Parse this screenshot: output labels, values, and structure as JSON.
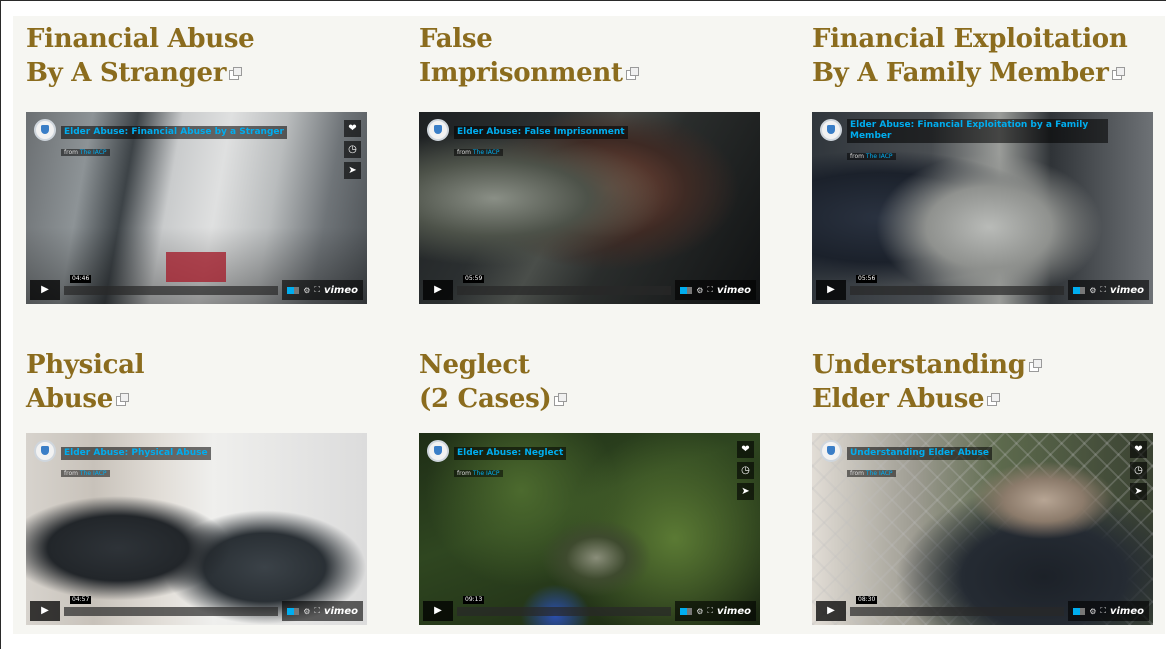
{
  "videos": [
    {
      "title_line1": "Financial Abuse",
      "title_line2": "By A Stranger",
      "video_title": "Elder Abuse: Financial Abuse by a Stranger",
      "from_label": "from",
      "from_name": "The IACP",
      "time": "04:46"
    },
    {
      "title_line1": "False",
      "title_line2": "Imprisonment",
      "video_title": "Elder Abuse: False Imprisonment",
      "from_label": "from",
      "from_name": "The IACP",
      "time": "05:59"
    },
    {
      "title_line1": "Financial Exploitation",
      "title_line2": "By A Family Member",
      "video_title": "Elder Abuse: Financial Exploitation by a Family Member",
      "from_label": "from",
      "from_name": "The IACP",
      "time": "05:56"
    },
    {
      "title_line1": "Physical",
      "title_line2": "Abuse",
      "video_title": "Elder Abuse: Physical Abuse",
      "from_label": "from",
      "from_name": "The IACP",
      "time": "04:57"
    },
    {
      "title_line1": "Neglect",
      "title_line2": "(2 Cases)",
      "video_title": "Elder Abuse: Neglect",
      "from_label": "from",
      "from_name": "The IACP",
      "time": "09:13"
    },
    {
      "title_line1": "Understanding",
      "title_line2": "Elder Abuse",
      "video_title": "Understanding Elder Abuse",
      "from_label": "from",
      "from_name": "The IACP",
      "time": "08:30"
    }
  ],
  "player": {
    "play_glyph": "▶",
    "vimeo_label": "vimeo",
    "heart_glyph": "❤",
    "clock_glyph": "◷",
    "send_glyph": "➤",
    "gear_glyph": "⚙",
    "fullscreen_glyph": "⛶"
  },
  "colors": {
    "heading": "#8b6c1e",
    "panel": "#f6f6f2",
    "vimeo_accent": "#00adef"
  }
}
